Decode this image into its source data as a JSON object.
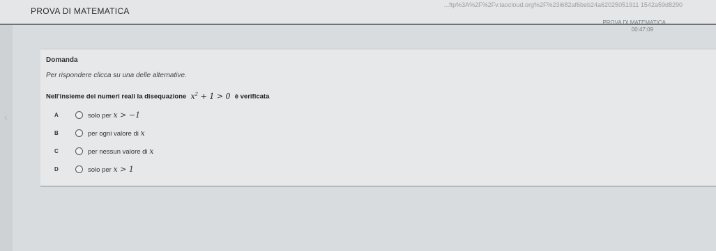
{
  "header": {
    "app_title": "PROVA DI MATEMATICA",
    "url_fragment": "...ftp%3A%2F%2Fv.taocloud.org%2F%23i682af6beb24a62025051911 1542a59d8290",
    "exam_name": "PROVA DI MATEMATICA",
    "timer": "00:47:09"
  },
  "nav": {
    "prev_glyph": "‹"
  },
  "question": {
    "section_title": "Domanda",
    "instruction": "Per rispondere clicca su una delle alternative.",
    "stem_before": "Nell'insieme dei numeri reali la disequazione",
    "stem_math_base": "x",
    "stem_math_exp": "2",
    "stem_math_rest": " + 1 > 0",
    "stem_after": "è verificata",
    "options": [
      {
        "letter": "A",
        "text": "solo per ",
        "math": "x > −1"
      },
      {
        "letter": "B",
        "text": "per ogni valore di ",
        "math": "x"
      },
      {
        "letter": "C",
        "text": "per nessun valore di ",
        "math": "x"
      },
      {
        "letter": "D",
        "text": "solo per ",
        "math": "x > 1"
      }
    ]
  }
}
